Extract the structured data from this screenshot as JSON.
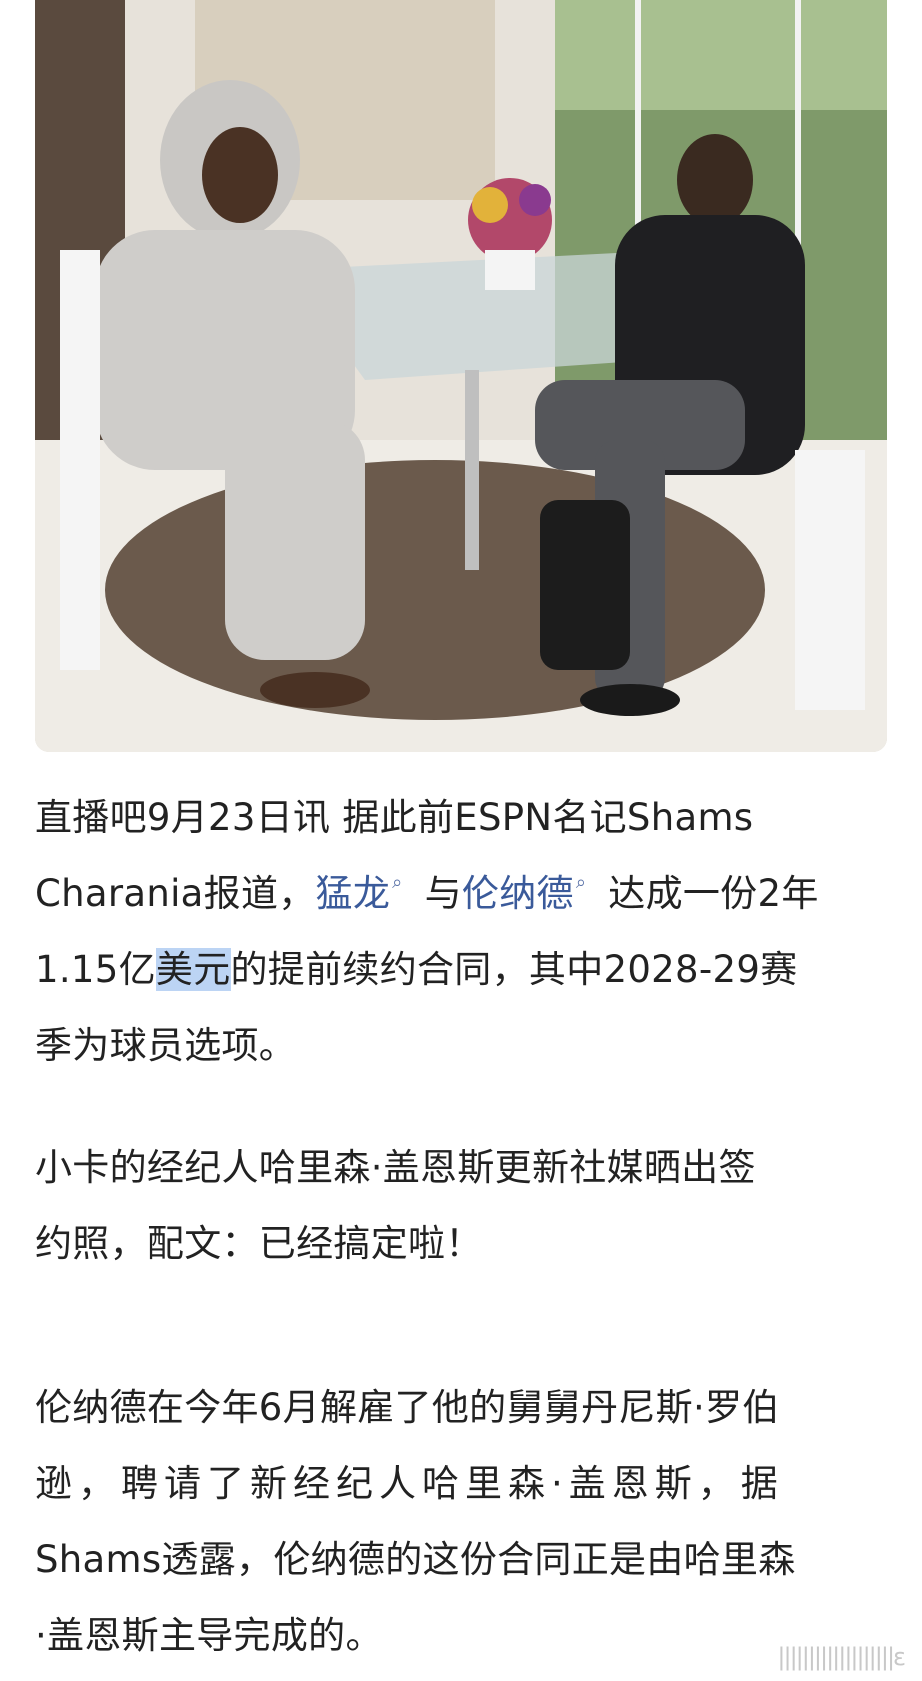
{
  "image": {
    "alt": "photo"
  },
  "article": {
    "p1": {
      "line1": "直播吧9月23日讯 据此前ESPN名记Shams",
      "line2_pre": "Charania报道，",
      "link1": "猛龙",
      "link1_icon": "search-icon",
      "mid": " 与",
      "link2": "伦纳德",
      "link2_icon": "search-icon",
      "line2_post": " 达成一份2年",
      "line3_pre": "1.15亿",
      "highlight": "美元",
      "line3_post": "的提前续约合同，其中2028-29赛",
      "line4": "季为球员选项。"
    },
    "p2": {
      "line1": "小卡的经纪人哈里森·盖恩斯更新社媒晒出签",
      "line2": "约照，配文：已经搞定啦！"
    },
    "p3": {
      "line1": "伦纳德在今年6月解雇了他的舅舅丹尼斯·罗伯",
      "line2": "逊，聘请了新经纪人哈里森·盖恩斯，据",
      "line3": "Shams透露，伦纳德的这份合同正是由哈里森",
      "line4": "·盖恩斯主导完成的。"
    }
  },
  "watermark": "|||||||||||||||||||ε"
}
